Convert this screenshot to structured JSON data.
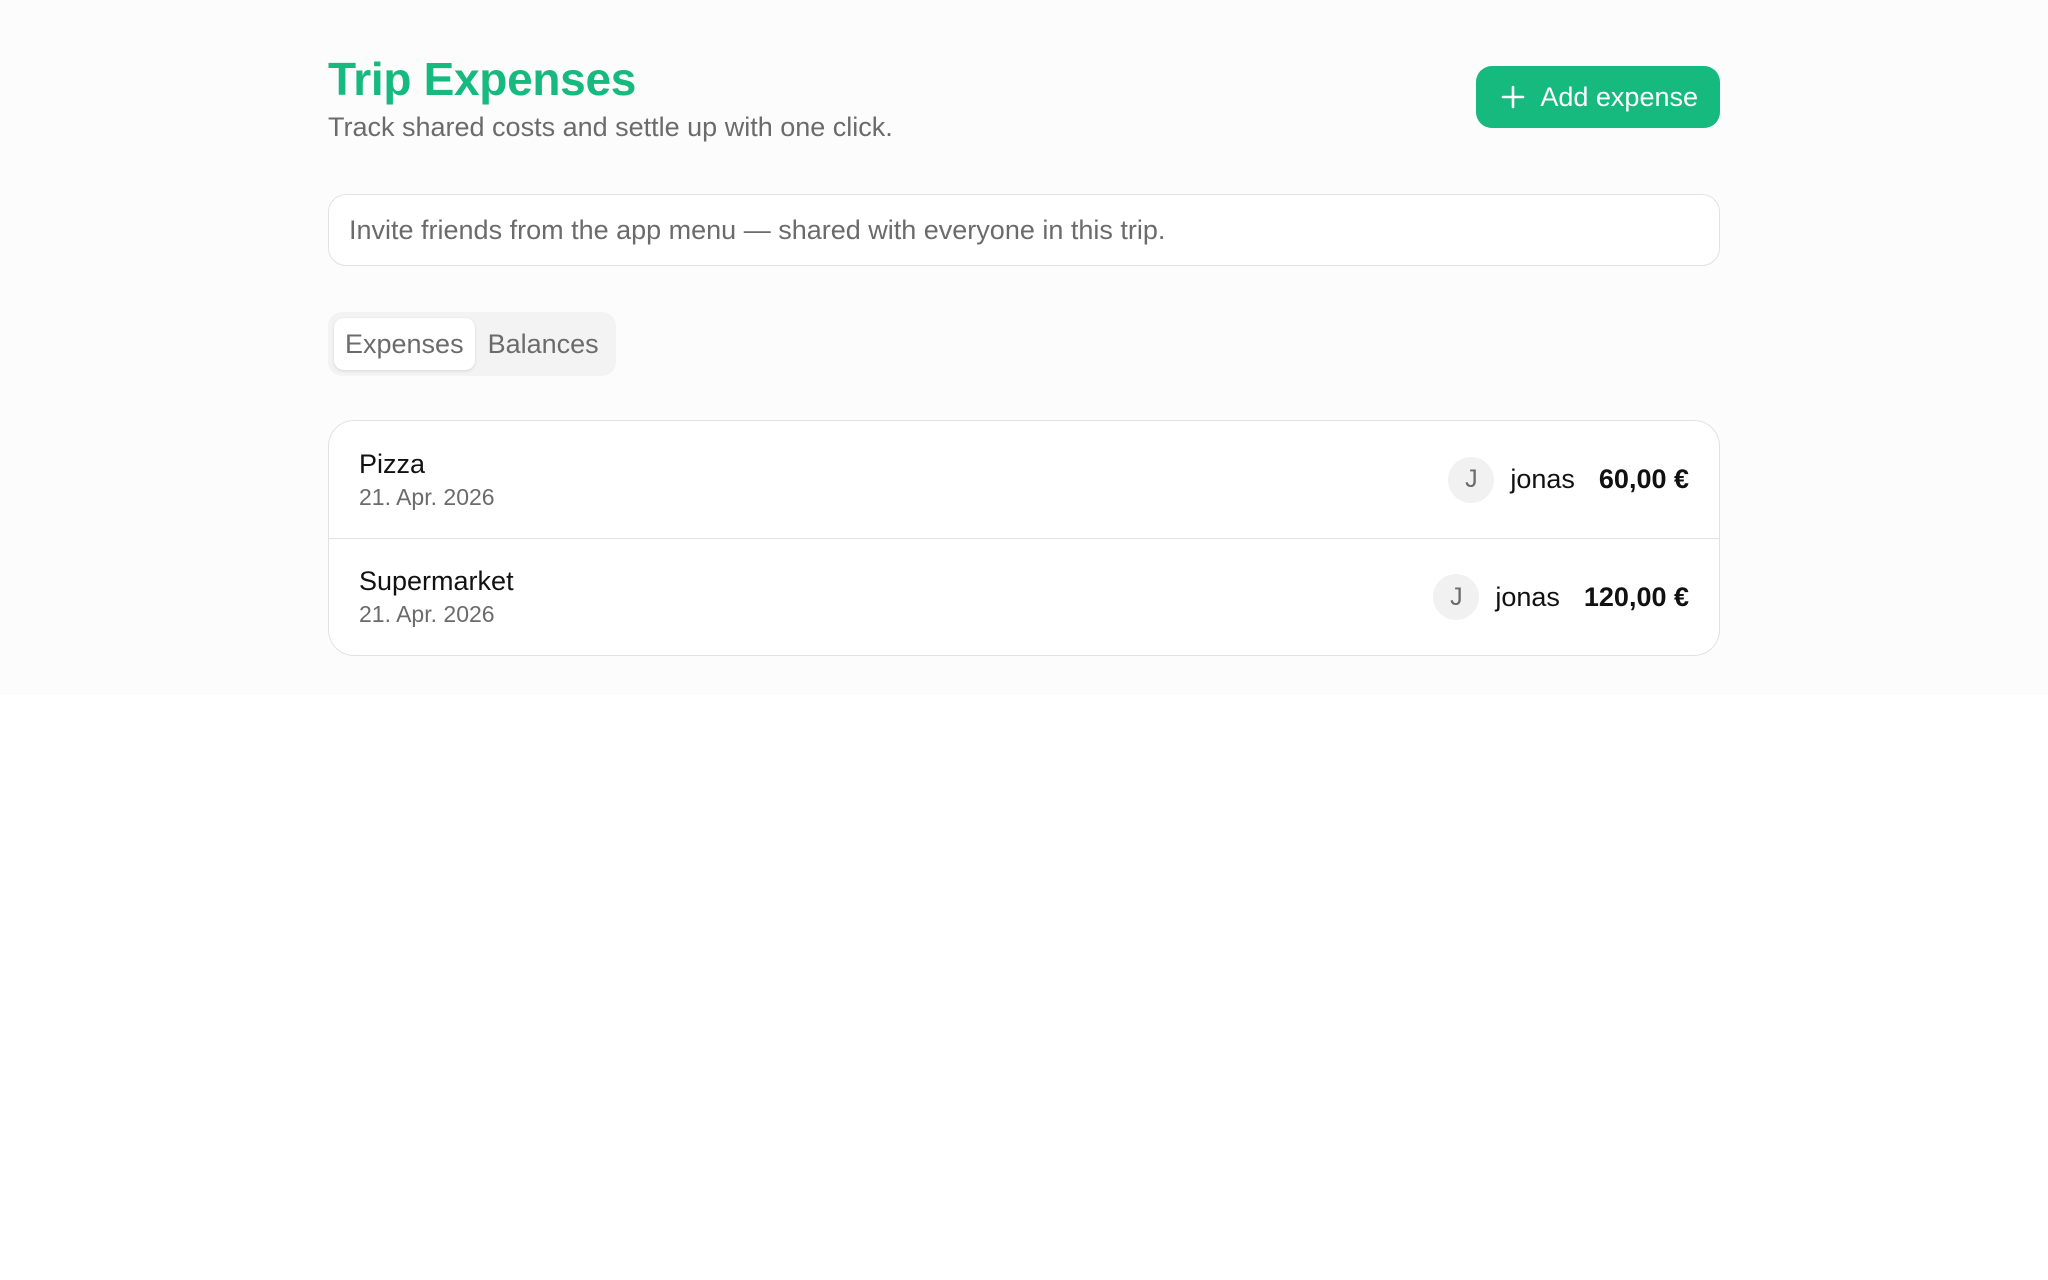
{
  "header": {
    "title": "Trip Expenses",
    "subtitle": "Track shared costs and settle up with one click.",
    "add_button_label": "Add expense",
    "add_button_icon": "plus-icon"
  },
  "info": {
    "text": "Invite friends from the app menu — shared with everyone in this trip."
  },
  "tabs": [
    {
      "label": "Expenses",
      "active": true
    },
    {
      "label": "Balances",
      "active": false
    }
  ],
  "expenses": [
    {
      "title": "Pizza",
      "date": "21. Apr. 2026",
      "avatar_initial": "J",
      "payer": "jonas",
      "amount": "60,00 €"
    },
    {
      "title": "Supermarket",
      "date": "21. Apr. 2026",
      "avatar_initial": "J",
      "payer": "jonas",
      "amount": "120,00 €"
    }
  ],
  "colors": {
    "accent": "#16b97e",
    "muted_text": "#6b6b6b",
    "border": "#e2e2e2",
    "background": "#fcfcfc"
  }
}
